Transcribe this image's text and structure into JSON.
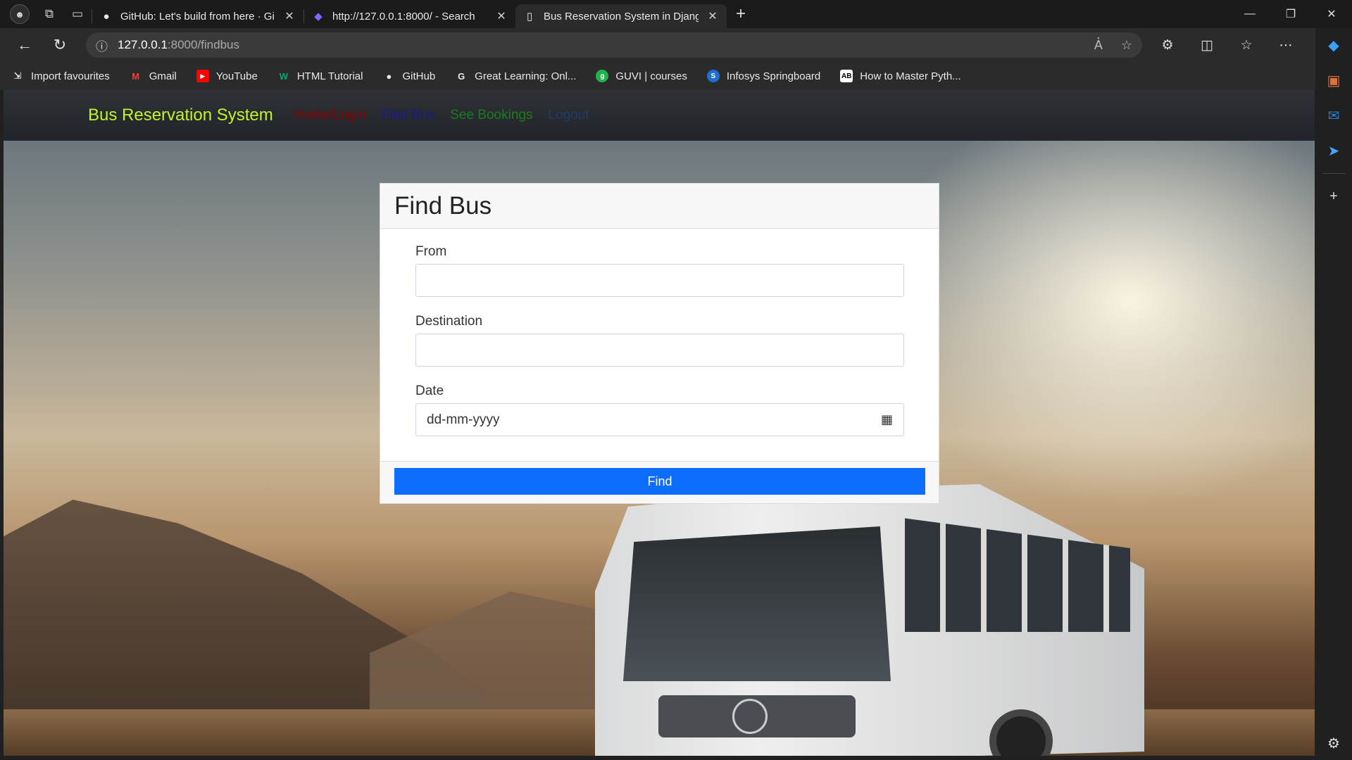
{
  "browser": {
    "tabs": [
      {
        "title": "GitHub: Let's build from here · Gi",
        "icon": "github-icon"
      },
      {
        "title": "http://127.0.0.1:8000/ - Search",
        "icon": "copilot-icon"
      },
      {
        "title": "Bus Reservation System in Djang",
        "icon": "page-icon",
        "active": true
      }
    ],
    "url_host": "127.0.0.1",
    "url_path": ":8000/findbus",
    "bookmarks": [
      {
        "label": "Import favourites",
        "icon": "import-icon"
      },
      {
        "label": "Gmail",
        "icon": "gmail-icon",
        "color": "#ea4335"
      },
      {
        "label": "YouTube",
        "icon": "youtube-icon",
        "color": "#ff0000"
      },
      {
        "label": "HTML Tutorial",
        "icon": "w3schools-icon",
        "color": "#04aa6d"
      },
      {
        "label": "GitHub",
        "icon": "github-icon",
        "color": "#ffffff"
      },
      {
        "label": "Great Learning: Onl...",
        "icon": "google-icon",
        "color": "#ffffff"
      },
      {
        "label": "GUVI | courses",
        "icon": "guvi-icon",
        "color": "#22b14c"
      },
      {
        "label": "Infosys Springboard",
        "icon": "infosys-icon",
        "color": "#1f6fd1"
      },
      {
        "label": "How to Master Pyth...",
        "icon": "ab-icon",
        "color": "#ffffff"
      }
    ]
  },
  "site": {
    "brand": "Bus Reservation System",
    "nav": [
      {
        "label": "Home/Login",
        "color": "#8b0000"
      },
      {
        "label": "Find Bus",
        "color": "#1a1a8c"
      },
      {
        "label": "See Bookings",
        "color": "#1f7a1f"
      },
      {
        "label": "Logout",
        "color": "#1f3a6b"
      }
    ]
  },
  "form": {
    "title": "Find Bus",
    "from_label": "From",
    "from_value": "",
    "destination_label": "Destination",
    "destination_value": "",
    "date_label": "Date",
    "date_placeholder": "dd-mm-yyyy",
    "submit_label": "Find",
    "submit_color": "#0d6efd"
  }
}
